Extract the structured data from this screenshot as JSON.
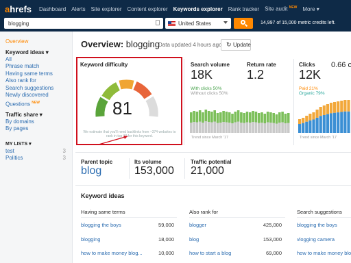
{
  "nav": {
    "logo_a": "a",
    "logo_rest": "hrefs",
    "items": [
      "Dashboard",
      "Alerts",
      "Site explorer",
      "Content explorer",
      "Keywords explorer",
      "Rank tracker",
      "Site audit",
      "More ▾"
    ],
    "new_badge": "NEW"
  },
  "search": {
    "query": "blogging",
    "country": "United States",
    "credits": "14,997 of 15,000 metric credits left."
  },
  "sidebar": {
    "overview": "Overview",
    "keyword_ideas_head": "Keyword ideas ▾",
    "keyword_ideas": [
      "All",
      "Phrase match",
      "Having same terms",
      "Also rank for",
      "Search suggestions",
      "Newly discovered",
      "Questions"
    ],
    "questions_badge": "NEW",
    "traffic_share_head": "Traffic share ▾",
    "traffic_share": [
      "By domains",
      "By pages"
    ],
    "my_lists_head": "MY LISTS ▾",
    "lists": [
      {
        "name": "test",
        "count": "3"
      },
      {
        "name": "Politics",
        "count": "3"
      }
    ]
  },
  "overview": {
    "title": "Overview:",
    "keyword": "blogging",
    "updated": "Data updated 4 hours ago",
    "update_btn": "Update"
  },
  "kd": {
    "label": "Keyword difficulty",
    "value": "81",
    "note": "We estimate that you'll need backlinks from ~374 websites to rank in top 10 for this keyword."
  },
  "volume": {
    "label": "Search volume",
    "value": "18K",
    "clicks": "With clicks 50%",
    "noclicks": "Without clicks 50%",
    "trend": "Trend since March '17"
  },
  "return_rate": {
    "label": "Return rate",
    "value": "1.2"
  },
  "clicks": {
    "label": "Clicks",
    "value": "12K",
    "paid": "Paid 21%",
    "organic": "Organic 79%",
    "trend": "Trend since March '17"
  },
  "cps": {
    "value": "0.66 c"
  },
  "parent": {
    "label": "Parent topic",
    "value": "blog"
  },
  "its_volume": {
    "label": "Its volume",
    "value": "153,000"
  },
  "traffic_potential": {
    "label": "Traffic potential",
    "value": "21,000"
  },
  "ideas": {
    "title": "Keyword ideas",
    "cols": [
      {
        "head": "Having same terms",
        "rows": [
          [
            "blogging the boys",
            "59,000"
          ],
          [
            "blogging",
            "18,000"
          ],
          [
            "how to make money blog...",
            "10,000"
          ]
        ]
      },
      {
        "head": "Also rank for",
        "rows": [
          [
            "blogger",
            "425,000"
          ],
          [
            "blog",
            "153,000"
          ],
          [
            "how to start a blog",
            "69,000"
          ]
        ]
      },
      {
        "head": "Search suggestions",
        "rows": [
          [
            "blogging the boys",
            ""
          ],
          [
            "vlogging camera",
            ""
          ],
          [
            "how to make money blo...",
            ""
          ]
        ]
      }
    ]
  },
  "colors": {
    "accent": "#ff8800",
    "nav_bg": "#0e2a47",
    "link": "#2b6cb0",
    "highlight": "#d0101d"
  }
}
